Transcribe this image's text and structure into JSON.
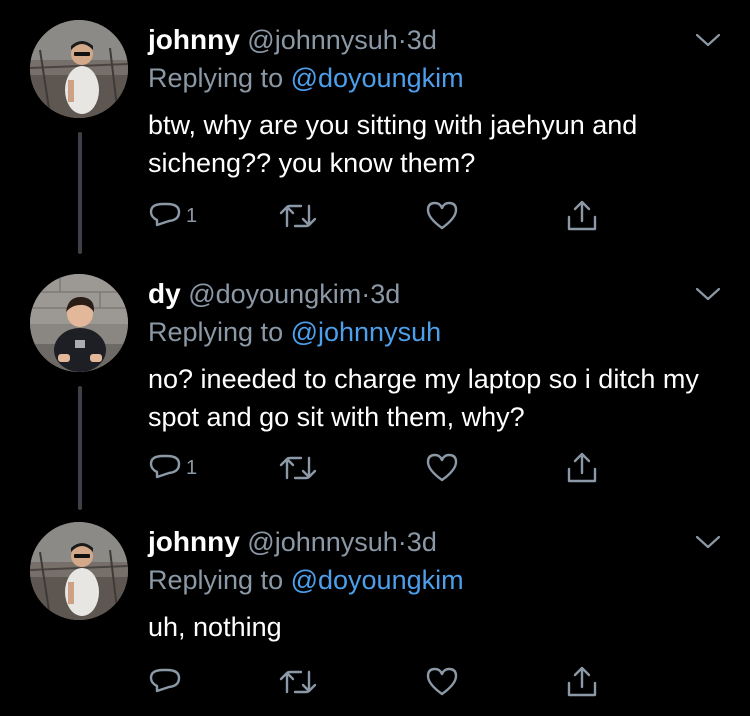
{
  "colors": {
    "background": "#000000",
    "text": "#ffffff",
    "secondary": "#8b98a5",
    "link": "#4d9fec",
    "thread_line": "#3d4147"
  },
  "tweets": [
    {
      "name": "johnny",
      "handle": "@johnnysuh",
      "separator": "·",
      "time": "3d",
      "replying_prefix": "Replying to ",
      "replying_to": "@doyoungkim",
      "text": "btw, why are you sitting with jaehyun and sicheng?? you know them?",
      "reply_count": "1",
      "icons": [
        "reply-icon",
        "retweet-icon",
        "like-icon",
        "share-icon",
        "chevron-down-icon"
      ]
    },
    {
      "name": "dy",
      "handle": "@doyoungkim",
      "separator": "·",
      "time": "3d",
      "replying_prefix": "Replying to ",
      "replying_to": "@johnnysuh",
      "text": "no? ineeded to charge my laptop so i ditch my spot and go sit with them, why?",
      "reply_count": "1",
      "icons": [
        "reply-icon",
        "retweet-icon",
        "like-icon",
        "share-icon",
        "chevron-down-icon"
      ]
    },
    {
      "name": "johnny",
      "handle": "@johnnysuh",
      "separator": "·",
      "time": "3d",
      "replying_prefix": "Replying to ",
      "replying_to": "@doyoungkim",
      "text": "uh, nothing",
      "reply_count": "",
      "icons": [
        "reply-icon",
        "retweet-icon",
        "like-icon",
        "share-icon",
        "chevron-down-icon"
      ]
    }
  ]
}
